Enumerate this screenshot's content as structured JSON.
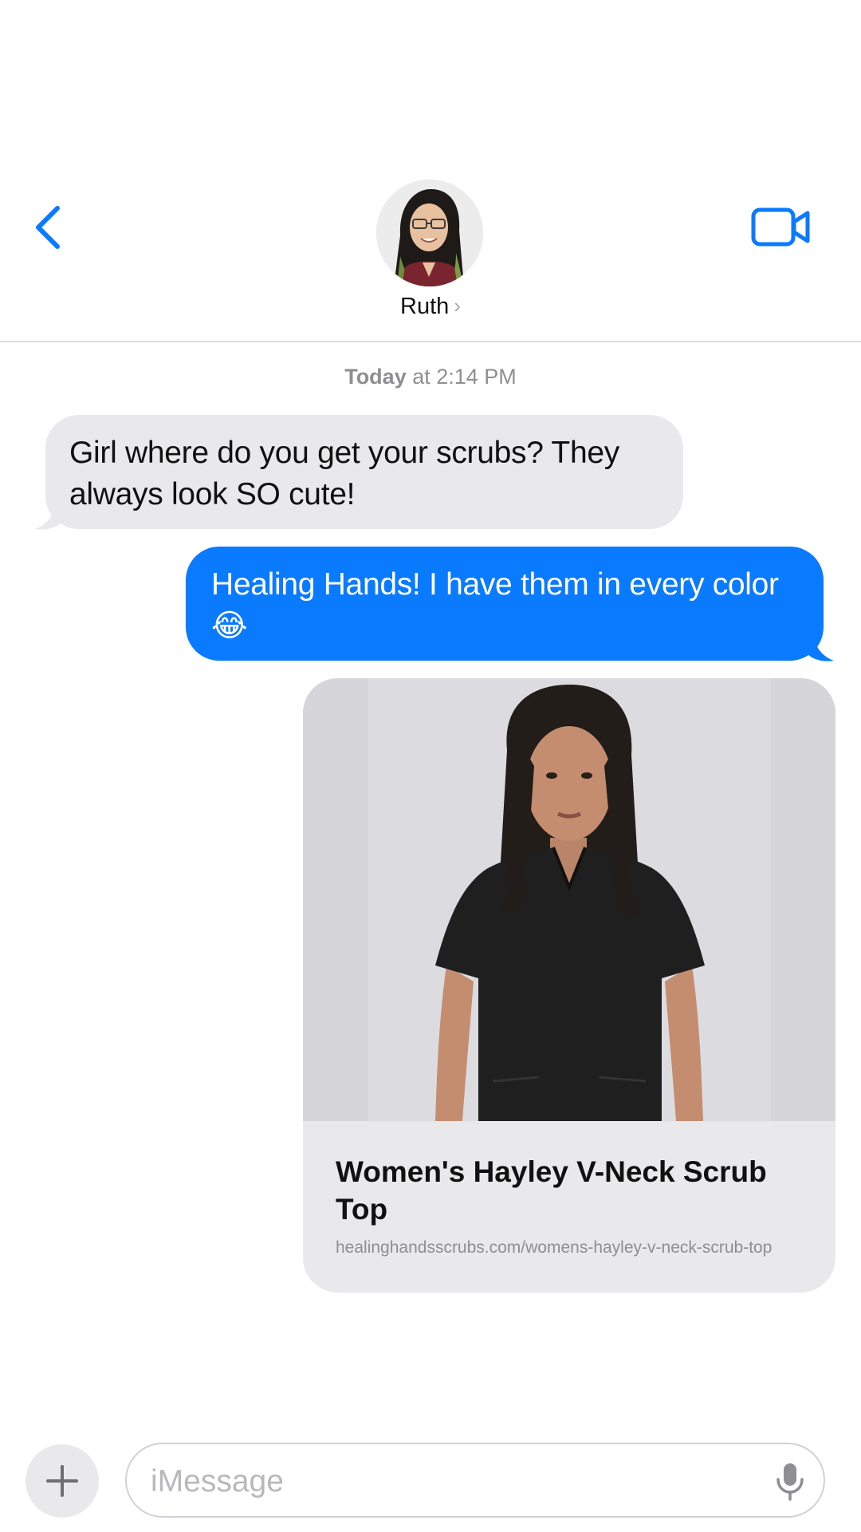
{
  "header": {
    "contact_name": "Ruth",
    "chevron_glyph": "›",
    "back_icon": "chevron-left-icon",
    "video_icon": "video-camera-icon"
  },
  "conversation": {
    "timestamp_day": "Today",
    "timestamp_time": " at 2:14 PM",
    "messages": [
      {
        "from": "Ruth",
        "text": "Girl where do you get your scrubs? They always look SO cute!"
      },
      {
        "from": "me",
        "text": "Healing Hands! I have them in every color 😂"
      }
    ],
    "link_preview": {
      "title": "Women's Hayley V-Neck Scrub Top",
      "url": "healinghandsscrubs.com/womens-hayley-v-neck-scrub-top"
    }
  },
  "composer": {
    "placeholder": "iMessage",
    "plus_icon": "plus-icon",
    "mic_icon": "microphone-icon"
  },
  "colors": {
    "accent": "#0a7aff",
    "incoming_bubble": "#e9e9eb",
    "secondary_text": "#8e8e93"
  }
}
